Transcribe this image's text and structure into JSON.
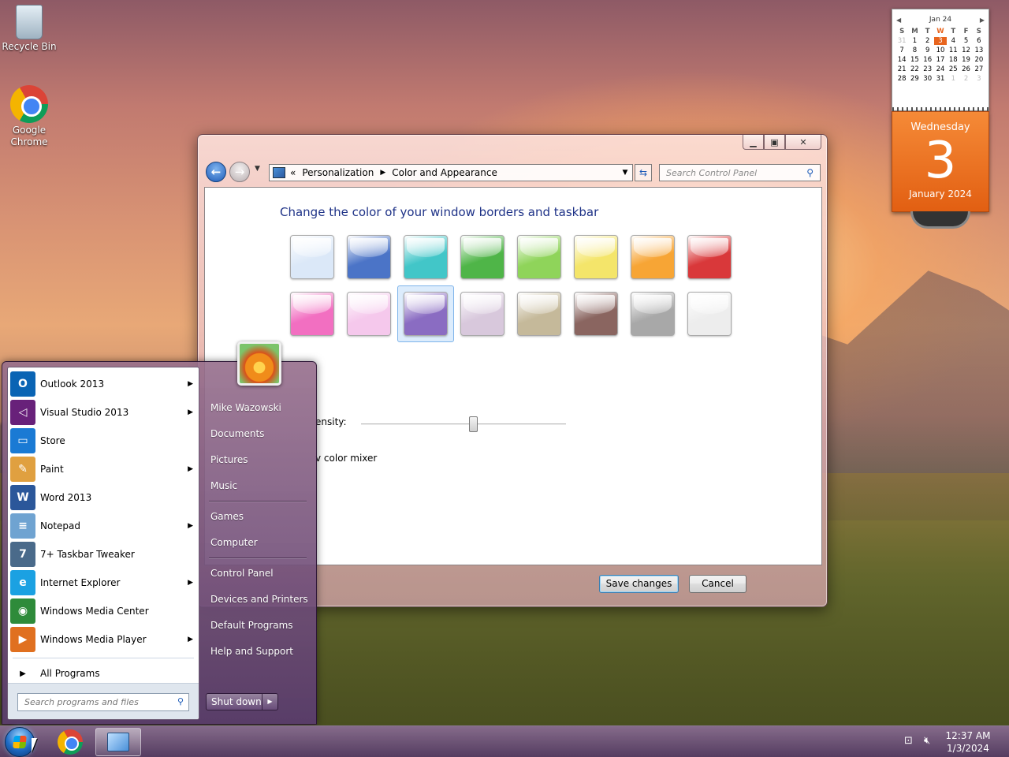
{
  "desktop": {
    "icons": [
      {
        "label": "Recycle Bin",
        "icon": "recycle-bin-icon"
      },
      {
        "label": "Google Chrome",
        "icon": "chrome-icon"
      }
    ]
  },
  "calendar": {
    "month_label": "Jan 24",
    "weekdays": [
      "S",
      "M",
      "T",
      "W",
      "T",
      "F",
      "S"
    ],
    "days": [
      "31",
      "1",
      "2",
      "3",
      "4",
      "5",
      "6",
      "7",
      "8",
      "9",
      "10",
      "11",
      "12",
      "13",
      "14",
      "15",
      "16",
      "17",
      "18",
      "19",
      "20",
      "21",
      "22",
      "23",
      "24",
      "25",
      "26",
      "27",
      "28",
      "29",
      "30",
      "31",
      "1",
      "2",
      "3"
    ],
    "today": "3",
    "weekday_name": "Wednesday",
    "day_number": "3",
    "month_year": "January 2024"
  },
  "window": {
    "breadcrumb_prefix": "«",
    "breadcrumb": [
      "Personalization",
      "Color and Appearance"
    ],
    "search_placeholder": "Search Control Panel",
    "heading": "Change the color of your window borders and taskbar",
    "swatches_row1": [
      "#dbe8f8",
      "#4b74c7",
      "#42c6c8",
      "#4fb548",
      "#8fd45a",
      "#f4e56a",
      "#f7a535",
      "#d9383a"
    ],
    "swatches_row2": [
      "#f26fc1",
      "#f5c8ec",
      "#8a6cc2",
      "#d8c8dc",
      "#c5b99a",
      "#8a6560",
      "#a8a8a8",
      "#ededed"
    ],
    "selected_swatch": 10,
    "intensity_label": "ensity:",
    "intensity_value": 0.55,
    "mixer_label": "v color mixer",
    "save_button": "Save changes",
    "cancel_button": "Cancel"
  },
  "start_menu": {
    "programs": [
      {
        "label": "Outlook 2013",
        "submenu": true,
        "color": "#0a64b4",
        "glyph": "O"
      },
      {
        "label": "Visual Studio 2013",
        "submenu": true,
        "color": "#68217a",
        "glyph": "◁"
      },
      {
        "label": "Store",
        "submenu": false,
        "color": "#1a7ad4",
        "glyph": "▭"
      },
      {
        "label": "Paint",
        "submenu": true,
        "color": "#e0a040",
        "glyph": "✎"
      },
      {
        "label": "Word 2013",
        "submenu": false,
        "color": "#2b579a",
        "glyph": "W"
      },
      {
        "label": "Notepad",
        "submenu": true,
        "color": "#6fa3d1",
        "glyph": "≡"
      },
      {
        "label": "7+ Taskbar Tweaker",
        "submenu": false,
        "color": "#4a6a8a",
        "glyph": "7"
      },
      {
        "label": "Internet Explorer",
        "submenu": true,
        "color": "#1ba1e2",
        "glyph": "e"
      },
      {
        "label": "Windows Media Center",
        "submenu": false,
        "color": "#2e8b3a",
        "glyph": "◉"
      },
      {
        "label": "Windows Media Player",
        "submenu": true,
        "color": "#e07020",
        "glyph": "▶"
      }
    ],
    "all_programs": "All Programs",
    "search_placeholder": "Search programs and files",
    "right_items": [
      "Mike Wazowski",
      "Documents",
      "Pictures",
      "Music",
      "Games",
      "Computer",
      "Control Panel",
      "Devices and Printers",
      "Default Programs",
      "Help and Support"
    ],
    "shutdown": "Shut down"
  },
  "taskbar": {
    "time": "12:37 AM",
    "date": "1/3/2024"
  }
}
